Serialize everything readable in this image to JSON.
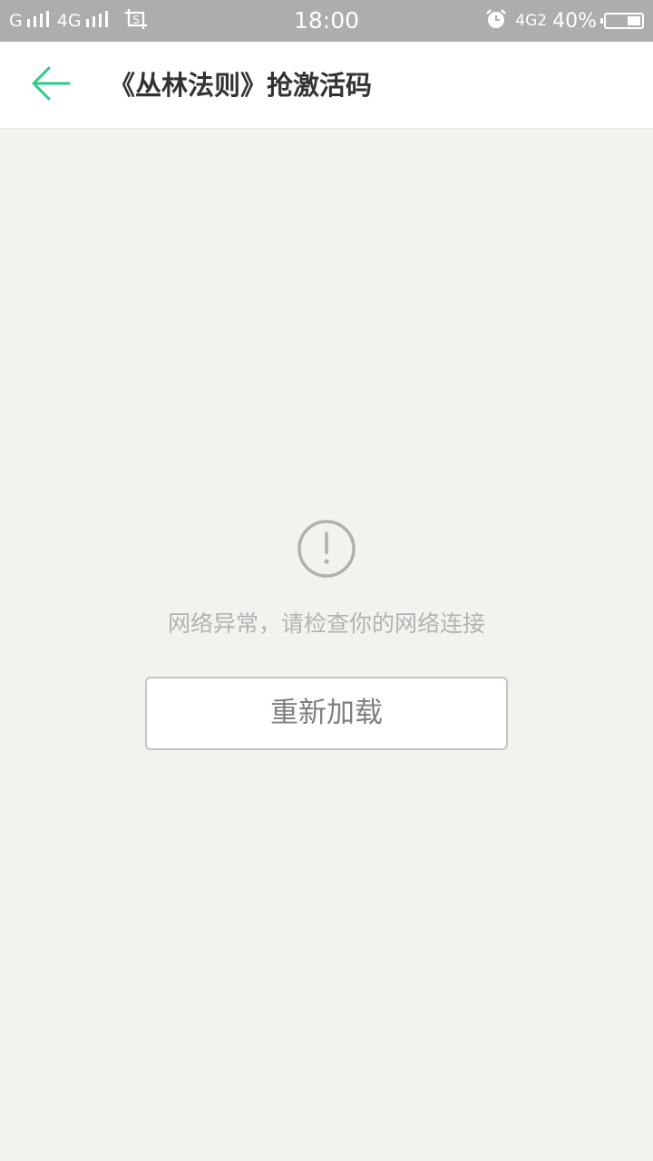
{
  "status_bar": {
    "carrier1": "G",
    "carrier2": "4G",
    "time": "18:00",
    "network_right": "4G2",
    "battery": "40%",
    "battery_level": 0.4,
    "screenshot_icon": "screenshot-icon",
    "alarm_icon": "alarm-icon"
  },
  "header": {
    "title": "《丛林法则》抢激活码",
    "back_icon": "back-arrow-icon",
    "accent_color": "#2ecb86"
  },
  "main": {
    "error_icon": "exclamation-circle-icon",
    "error_message": "网络异常，请检查你的网络连接",
    "reload_label": "重新加载"
  }
}
